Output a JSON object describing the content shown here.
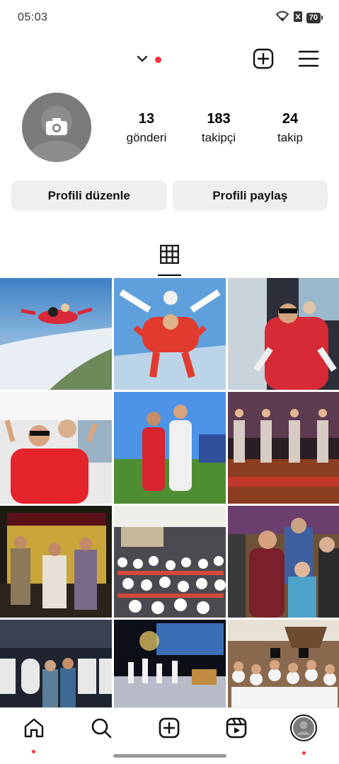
{
  "status_bar": {
    "time": "05:03",
    "battery": "70"
  },
  "header": {
    "has_notification": true
  },
  "profile": {
    "stats": [
      {
        "value": "13",
        "label": "gönderi"
      },
      {
        "value": "183",
        "label": "takipçi"
      },
      {
        "value": "24",
        "label": "takip"
      }
    ],
    "edit_button": "Profili düzenle",
    "share_button": "Profili paylaş"
  },
  "colors": {
    "accent_red": "#ff3040",
    "button_bg": "#efefef"
  },
  "tabs": [
    {
      "icon": "grid-icon",
      "active": true
    }
  ],
  "posts": [
    {
      "scene": "tandem skydive above coastline"
    },
    {
      "scene": "tandem skydivers in red suits"
    },
    {
      "scene": "skydivers inside aircraft door"
    },
    {
      "scene": "skydivers inside plane cabin"
    },
    {
      "scene": "two men in jumpsuits on grass field"
    },
    {
      "scene": "repeated stage photo collage"
    },
    {
      "scene": "actors on stage with gold curtain"
    },
    {
      "scene": "children audience in hall"
    },
    {
      "scene": "costumed man with child"
    },
    {
      "scene": "Hollywood letters stage backdrop"
    },
    {
      "scene": "stage performance lights"
    },
    {
      "scene": "children group with pirate costumes"
    }
  ],
  "bottom_nav": [
    {
      "name": "home"
    },
    {
      "name": "search"
    },
    {
      "name": "create"
    },
    {
      "name": "reels"
    },
    {
      "name": "profile"
    }
  ]
}
